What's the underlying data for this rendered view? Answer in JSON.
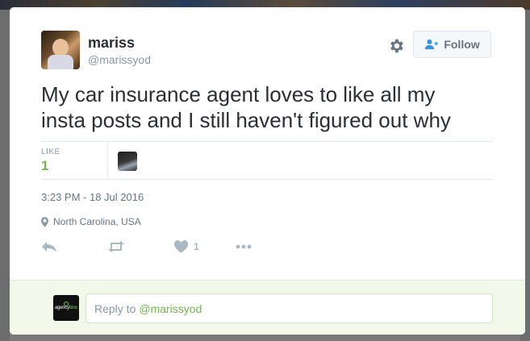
{
  "author": {
    "display_name": "mariss",
    "handle": "@marissyod"
  },
  "follow_button": {
    "label": "Follow"
  },
  "tweet": {
    "line1": "My car insurance agent loves to like all my",
    "line2": "insta posts and I still haven't figured out why"
  },
  "stats": {
    "likes_label": "LIKE",
    "likes_value": "1"
  },
  "meta": {
    "timestamp": "3:23 PM - 18 Jul 2016",
    "location": "North Carolina, USA"
  },
  "actions": {
    "like_count": "1"
  },
  "reply": {
    "prefix": "Reply to",
    "mention": "@marissyod",
    "avatar_logo_text_a": "agency",
    "avatar_logo_text_b": "bloc"
  },
  "colors": {
    "accent_green": "#77b255",
    "text_primary": "#292f33",
    "text_secondary": "#657786",
    "reply_bg": "#f2f8ea"
  },
  "icons": [
    "gear-icon",
    "follow-user-icon",
    "location-pin-icon",
    "reply-icon",
    "retweet-icon",
    "heart-icon",
    "more-icon"
  ]
}
